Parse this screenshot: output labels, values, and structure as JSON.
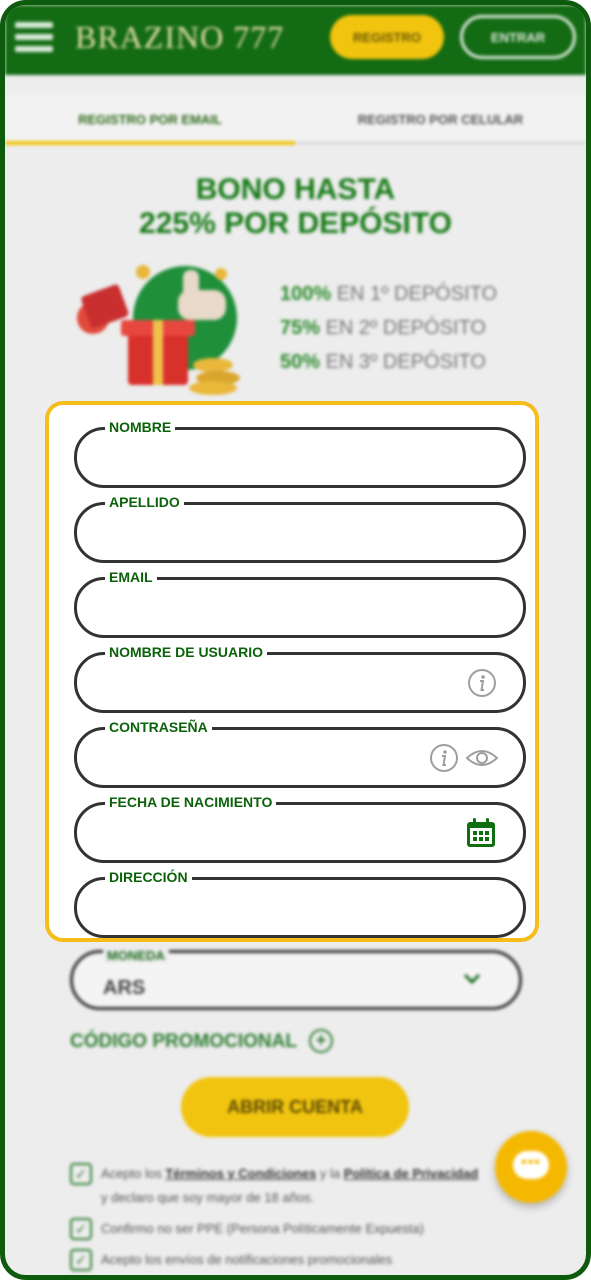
{
  "header": {
    "logo": "BRAZINO 777",
    "register_label": "REGISTRO",
    "login_label": "ENTRAR"
  },
  "tabs": [
    {
      "label": "REGISTRO POR EMAIL",
      "active": true
    },
    {
      "label": "REGISTRO POR CELULAR",
      "active": false
    }
  ],
  "promo": {
    "title_line1": "BONO HASTA",
    "title_line2": "225% POR DEPÓSITO",
    "lines": [
      {
        "pct": "100%",
        "text": " EN 1º DEPÓSITO"
      },
      {
        "pct": "75%",
        "text": " EN 2º DEPÓSITO"
      },
      {
        "pct": "50%",
        "text": " EN 3º DEPÓSITO"
      }
    ]
  },
  "form": {
    "fields": [
      {
        "label": "NOMBRE",
        "value": ""
      },
      {
        "label": "APELLIDO",
        "value": ""
      },
      {
        "label": "EMAIL",
        "value": ""
      },
      {
        "label": "NOMBRE DE USUARIO",
        "value": ""
      },
      {
        "label": "CONTRASEÑA",
        "value": ""
      },
      {
        "label": "FECHA DE NACIMIENTO",
        "value": ""
      },
      {
        "label": "DIRECCIÓN",
        "value": ""
      }
    ]
  },
  "currency": {
    "label": "MONEDA",
    "value": "ARS"
  },
  "promo_code_label": "CÓDIGO PROMOCIONAL",
  "submit_label": "ABRIR CUENTA",
  "checkboxes": [
    {
      "pre": "Acepto los ",
      "link1": "Términos y Condiciones",
      "mid": " y la ",
      "link2": "Política de Privacidad",
      "line2": "y declaro que soy mayor de 18 años."
    },
    {
      "text": "Confirmo no ser PPE (Persona Políticamente Expuesta)"
    },
    {
      "text": "Acepto los envíos de notificaciones promocionales"
    }
  ],
  "colors": {
    "brand_green": "#136b13",
    "accent_yellow": "#f1c40f",
    "highlight_border": "#f4bd1a",
    "label_green": "#0b620b"
  },
  "icons": [
    "menu-icon",
    "info-icon",
    "eye-icon",
    "calendar-icon",
    "chevron-down-icon",
    "plus-circle-icon",
    "check-icon",
    "chat-icon"
  ]
}
